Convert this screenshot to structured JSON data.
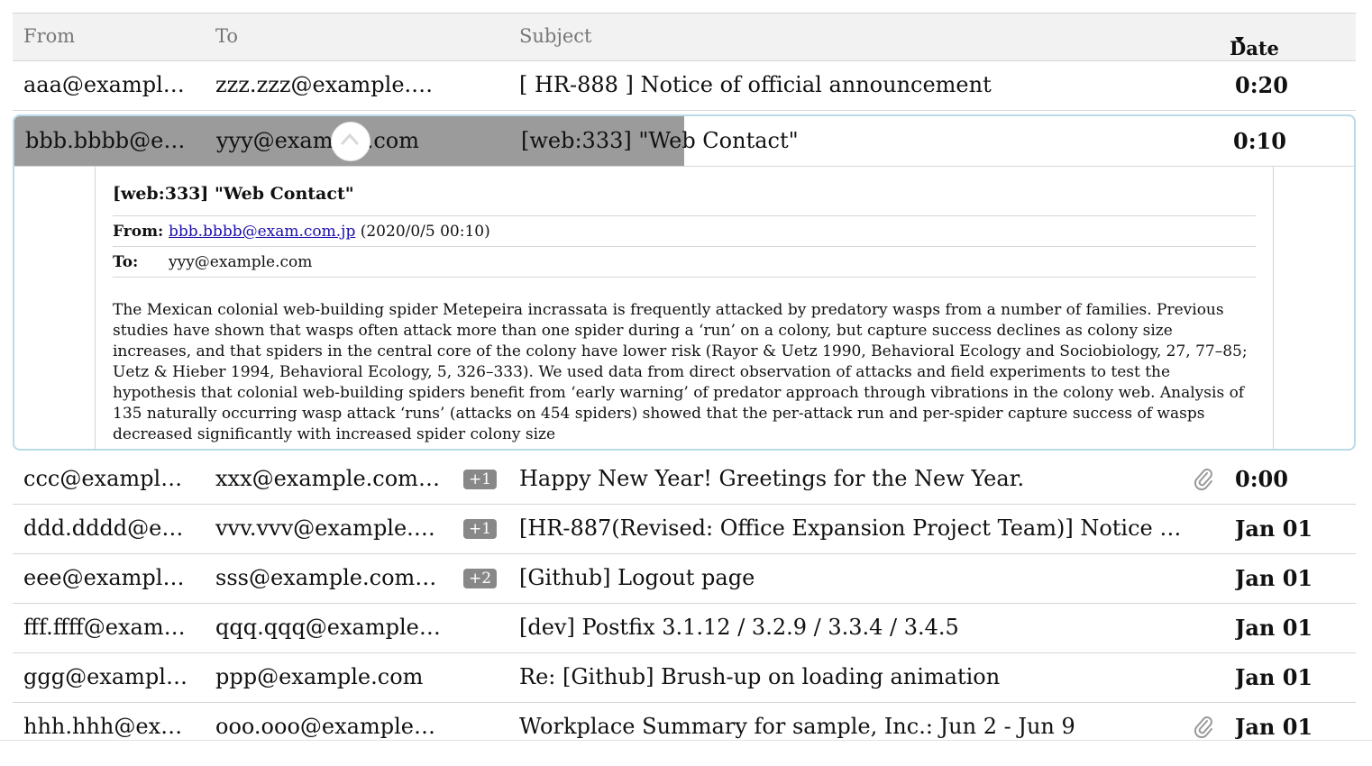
{
  "columns": {
    "from": "From",
    "to": "To",
    "subject": "Subject",
    "date": "Date"
  },
  "rows_before": [
    {
      "from": "aaa@example.c…",
      "to": "zzz.zzz@example.com",
      "subject": "[ HR-888 ] Notice of official announcement",
      "date": "0:20"
    }
  ],
  "expanded": {
    "row": {
      "from": "bbb.bbbb@exa…",
      "to": "yyy@example.com",
      "subject": "[web:333] \"Web Contact\"",
      "date": "0:10"
    },
    "load_progress": 0.5,
    "detail": {
      "title": "[web:333] \"Web Contact\"",
      "from_label": "From:",
      "from_email": "bbb.bbbb@exam.com.jp",
      "from_time": "(2020/0/5 00:10)",
      "to_label": "To:",
      "to_value": "yyy@example.com",
      "body": "The Mexican colonial web-building spider Metepeira incrassata is frequently attacked by predatory wasps from a number of families. Previous studies have shown that wasps often attack more than one spider during a ‘run’ on a colony, but capture success declines as colony size increases, and that spiders in the central core of the colony have lower risk (Rayor & Uetz 1990, Behavioral Ecology and Sociobiology, 27, 77–85; Uetz & Hieber 1994, Behavioral Ecology, 5, 326–333). We used data from direct observation of attacks and field experiments to test the hypothesis that colonial web-building spiders benefit from ‘early warning’ of predator approach through vibrations in the colony web. Analysis of 135 naturally occurring wasp attack ‘runs’ (attacks on 454 spiders) showed that the per-attack run and per-spider capture success of wasps decreased significantly with increased spider colony size"
    }
  },
  "rows_after": [
    {
      "from": "ccc@example.c…",
      "to": "xxx@example.com,x…",
      "badge": "+1",
      "subject": "Happy New Year! Greetings for the New Year.",
      "attachment": true,
      "date": "0:00"
    },
    {
      "from": "ddd.dddd@exa…",
      "to": "vvv.vvv@example.co…",
      "badge": "+1",
      "subject": "[HR-887(Revised: Office Expansion Project Team)] Notice of off-the…",
      "attachment": false,
      "date": "Jan 01"
    },
    {
      "from": "eee@example.c…",
      "to": "sss@example.com,sss…",
      "badge": "+2",
      "subject": "[Github] Logout page",
      "attachment": false,
      "date": "Jan 01"
    },
    {
      "from": "fff.ffff@exampl…",
      "to": "qqq.qqq@example.com",
      "badge": "",
      "subject": "[dev] Postfix 3.1.12 / 3.2.9 / 3.3.4 / 3.4.5",
      "attachment": false,
      "date": "Jan 01"
    },
    {
      "from": "ggg@example.…",
      "to": "ppp@example.com",
      "badge": "",
      "subject": "Re: [Github] Brush-up on loading animation",
      "attachment": false,
      "date": "Jan 01"
    },
    {
      "from": "hhh.hhh@exam…",
      "to": "ooo.ooo@example.com",
      "badge": "",
      "subject": "Workplace Summary for sample, Inc.: Jun 2 - Jun 9",
      "attachment": true,
      "date": "Jan 01"
    }
  ],
  "icons": {
    "attachment": "paperclip-icon",
    "collapse": "chevron-up-icon",
    "sort": "caret-down-icon"
  },
  "colors": {
    "header_bg": "#f2f2f3",
    "expanded_border": "#b8dbe6",
    "progress": "#9b9b9b",
    "badge": "#888888",
    "link": "#1a0dab"
  }
}
